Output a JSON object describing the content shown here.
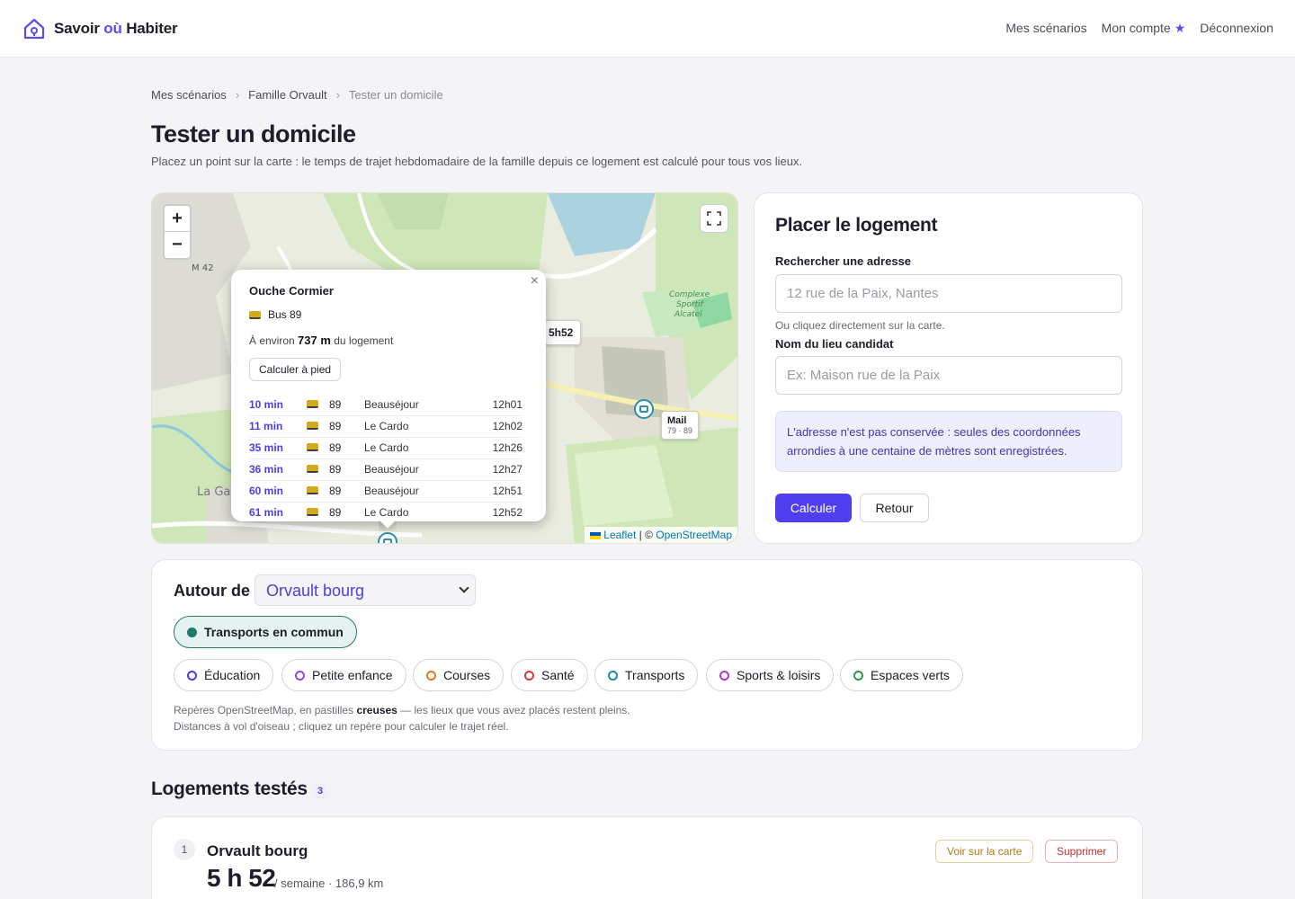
{
  "header": {
    "brand_prefix": "Savoir ",
    "brand_ou": "où",
    "brand_suffix": " Habiter",
    "nav": [
      "Mes scénarios",
      "Mon compte",
      "Déconnexion"
    ]
  },
  "breadcrumb": [
    "Mes scénarios",
    "Famille Orvault",
    "Tester un domicile"
  ],
  "page": {
    "title": "Tester un domicile",
    "subtitle": "Placez un point sur la carte : le temps de trajet hebdomadaire de la famille depuis ce logement est calculé pour tous vos lieux."
  },
  "map": {
    "zoom_in": "+",
    "zoom_out": "−",
    "time_tag": "5h52",
    "mail_tag": {
      "name": "Mail",
      "lines": "79 · 89"
    },
    "attribution": {
      "leaflet": "Leaflet",
      "sep": " | © ",
      "osm": "OpenStreetMap"
    },
    "labels": {
      "road_m42": "M 42",
      "complexe": "Complexe Sportif Alcatel",
      "la_ga": "La Ga"
    },
    "popup": {
      "title": "Ouche Cormier",
      "line": "Bus 89",
      "dist_prefix": "À environ ",
      "dist_value": "737 m",
      "dist_suffix": " du logement",
      "walk_button": "Calculer à pied",
      "departures": [
        {
          "min": "10 min",
          "line": "89",
          "dest": "Beauséjour",
          "time": "12h01"
        },
        {
          "min": "11 min",
          "line": "89",
          "dest": "Le Cardo",
          "time": "12h02"
        },
        {
          "min": "35 min",
          "line": "89",
          "dest": "Le Cardo",
          "time": "12h26"
        },
        {
          "min": "36 min",
          "line": "89",
          "dest": "Beauséjour",
          "time": "12h27"
        },
        {
          "min": "60 min",
          "line": "89",
          "dest": "Beauséjour",
          "time": "12h51"
        },
        {
          "min": "61 min",
          "line": "89",
          "dest": "Le Cardo",
          "time": "12h52"
        }
      ]
    }
  },
  "place": {
    "title": "Placer le logement",
    "search_label": "Rechercher une adresse",
    "search_placeholder": "12 rue de la Paix, Nantes",
    "hint": "Ou cliquez directement sur la carte.",
    "name_label": "Nom du lieu candidat",
    "name_placeholder": "Ex: Maison rue de la Paix",
    "notice": "L'adresse n'est pas conservée : seules des coordonnées arrondies à une centaine de mètres sont enregistrées.",
    "submit": "Calculer",
    "back": "Retour"
  },
  "around": {
    "label": "Autour de",
    "selected": "Orvault bourg",
    "active_chip": "Transports en commun",
    "chips": [
      {
        "label": "Éducation",
        "color": "#4b3fe0"
      },
      {
        "label": "Petite enfance",
        "color": "#8a4ee0"
      },
      {
        "label": "Courses",
        "color": "#e07a1f"
      },
      {
        "label": "Santé",
        "color": "#d93a3a"
      },
      {
        "label": "Transports",
        "color": "#1f8aa0"
      },
      {
        "label": "Sports & loisirs",
        "color": "#b03ac0"
      },
      {
        "label": "Espaces verts",
        "color": "#2a9a4a"
      }
    ],
    "note1_pre": "Repères OpenStreetMap, en pastilles ",
    "note1_bold": "creuses",
    "note1_post": " — les lieux que vous avez placés restent pleins.",
    "note2": "Distances à vol d'oiseau ; cliquez un repère pour calculer le trajet réel."
  },
  "tested": {
    "title": "Logements testés",
    "count": "3",
    "items": [
      {
        "num": "1",
        "name": "Orvault bourg",
        "time": "5 h 52",
        "meta": "/ semaine · 186,9 km",
        "show": "Voir sur la carte",
        "delete": "Supprimer"
      }
    ]
  }
}
